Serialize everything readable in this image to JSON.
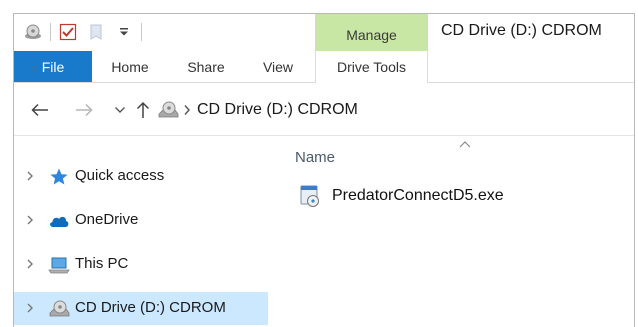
{
  "window": {
    "title": "CD Drive (D:) CDROM",
    "contextual_tab_group": "Manage"
  },
  "quick_access_toolbar": {
    "icons": [
      "cd-drive-icon",
      "properties-checkmark-icon",
      "new-folder-icon",
      "customize-dropdown-icon"
    ]
  },
  "ribbon": {
    "tabs": [
      {
        "label": "File",
        "active": true
      },
      {
        "label": "Home"
      },
      {
        "label": "Share"
      },
      {
        "label": "View"
      },
      {
        "label": "Drive Tools"
      }
    ]
  },
  "address": {
    "crumbs": [
      "CD Drive (D:) CDROM"
    ]
  },
  "nav": {
    "items": [
      {
        "label": "Quick access",
        "icon": "star-icon"
      },
      {
        "label": "OneDrive",
        "icon": "cloud-icon"
      },
      {
        "label": "This PC",
        "icon": "computer-icon"
      },
      {
        "label": "CD Drive (D:) CDROM",
        "icon": "cd-drive-icon",
        "selected": true
      }
    ]
  },
  "content": {
    "column_header": "Name",
    "files": [
      {
        "name": "PredatorConnectD5.exe",
        "icon": "installer-exe-icon"
      }
    ]
  },
  "colors": {
    "file_tab": "#1979ca",
    "manage_tab": "#c9e7a4",
    "selection": "#cce8ff"
  }
}
